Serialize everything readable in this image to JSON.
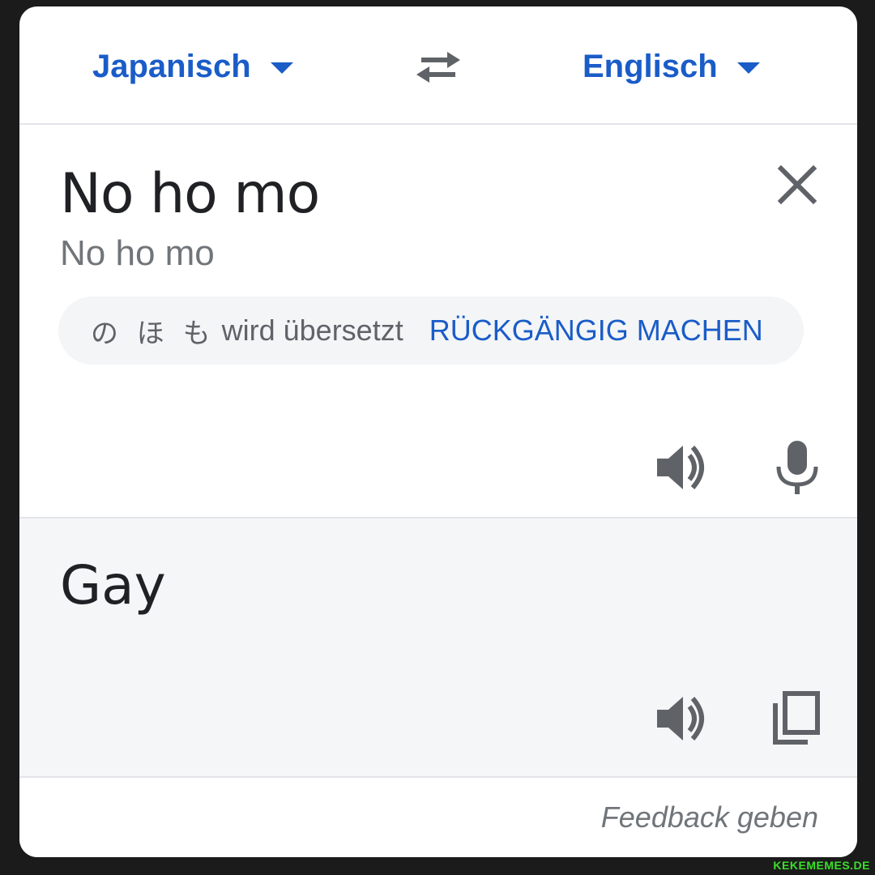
{
  "header": {
    "source_language": "Japanisch",
    "target_language": "Englisch",
    "swap_icon": "swap-horiz-icon"
  },
  "input": {
    "text": "No ho mo",
    "transliteration": "No ho mo",
    "chip": {
      "kana": "の ほ も",
      "info": "wird übersetzt",
      "undo_label": "RÜCKGÄNGIG MACHEN"
    }
  },
  "output": {
    "text": "Gay"
  },
  "footer": {
    "feedback_label": "Feedback geben"
  },
  "watermark": "KEKEMEMES.DE",
  "colors": {
    "accent": "#1a5cc8",
    "icon_gray": "#5f6368",
    "output_bg": "#f5f6f8"
  }
}
